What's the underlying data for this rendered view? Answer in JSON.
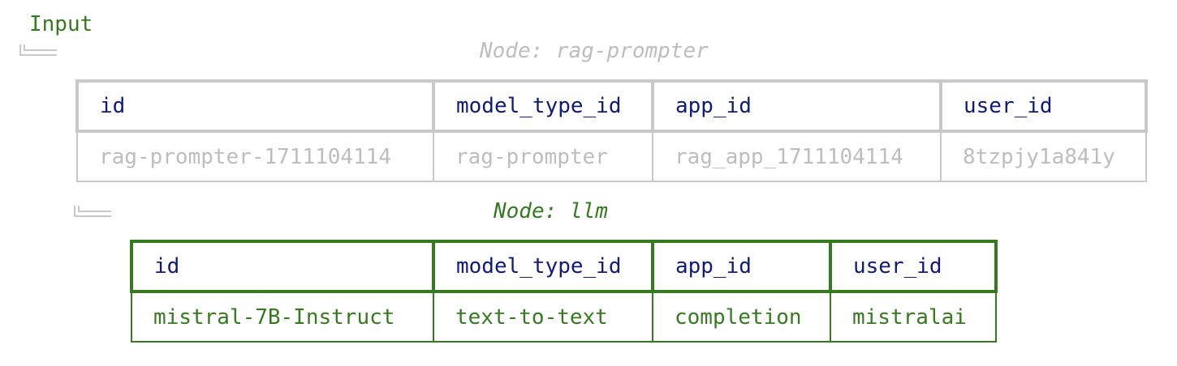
{
  "input_label": "Input",
  "nodes": [
    {
      "title": "Node: rag-prompter",
      "headers": [
        "id",
        "model_type_id",
        "app_id",
        "user_id"
      ],
      "values": [
        "rag-prompter-1711104114",
        "rag-prompter",
        "rag_app_1711104114",
        "8tzpjy1a841y"
      ],
      "color": "#bdbdbd"
    },
    {
      "title": "Node: llm",
      "headers": [
        "id",
        "model_type_id",
        "app_id",
        "user_id"
      ],
      "values": [
        "mistral-7B-Instruct",
        "text-to-text",
        "completion",
        "mistralai"
      ],
      "color": "#367a1f"
    }
  ],
  "colors": {
    "header_text": "#0f1a7a",
    "active": "#367a1f",
    "inactive": "#c8c8c8"
  }
}
